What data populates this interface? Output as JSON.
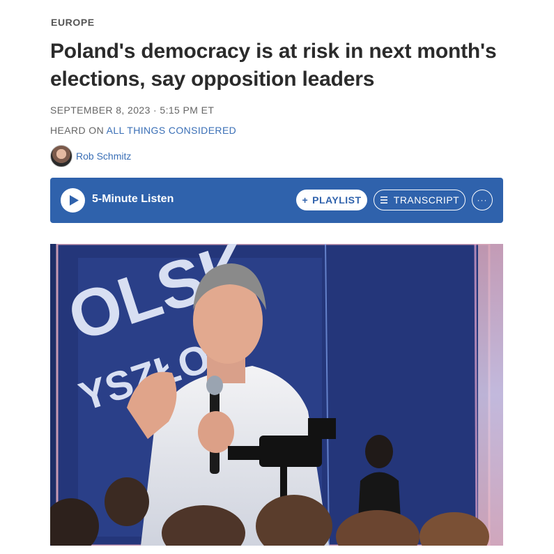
{
  "section": "EUROPE",
  "headline": "Poland's democracy is at risk in next month's elections, say opposition leaders",
  "dateline": "SEPTEMBER 8, 2023 · 5:15 PM ET",
  "heard": {
    "prefix": "HEARD ON",
    "show": "ALL THINGS CONSIDERED"
  },
  "author": {
    "name": "Rob Schmitz"
  },
  "player": {
    "listen_label": "5-Minute Listen",
    "playlist_label": "PLAYLIST",
    "playlist_glyph": "+",
    "transcript_label": "TRANSCRIPT",
    "more_glyph": "···"
  },
  "icons": {
    "play": "play-icon",
    "plus": "plus-icon",
    "transcript": "list-icon",
    "more": "more-icon"
  },
  "photo": {
    "backdrop_text_1": "OLSK",
    "backdrop_text_2": "YSZŁOS"
  },
  "colors": {
    "accent": "#2f62ac",
    "link": "#3a6fb6"
  }
}
